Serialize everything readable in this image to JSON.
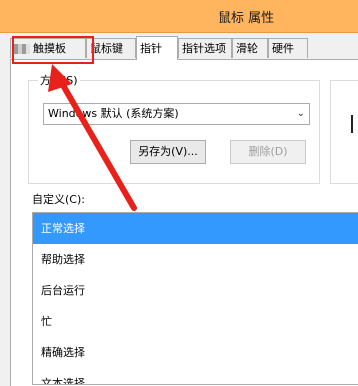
{
  "window": {
    "title": "鼠标 属性"
  },
  "tabs": [
    {
      "label": "触摸板",
      "active": false
    },
    {
      "label": "鼠标键",
      "active": false
    },
    {
      "label": "指针",
      "active": true
    },
    {
      "label": "指针选项",
      "active": false
    },
    {
      "label": "滑轮",
      "active": false
    },
    {
      "label": "硬件",
      "active": false
    }
  ],
  "scheme": {
    "label": "方案(S)",
    "value": "Windows 默认 (系统方案)",
    "save_as": "另存为(V)...",
    "delete": "删除(D)"
  },
  "customize": {
    "label": "自定义(C):",
    "items": [
      "正常选择",
      "帮助选择",
      "后台运行",
      "忙",
      "精确选择",
      "文本选择"
    ]
  },
  "annotation": {
    "color": "#e8221a"
  }
}
